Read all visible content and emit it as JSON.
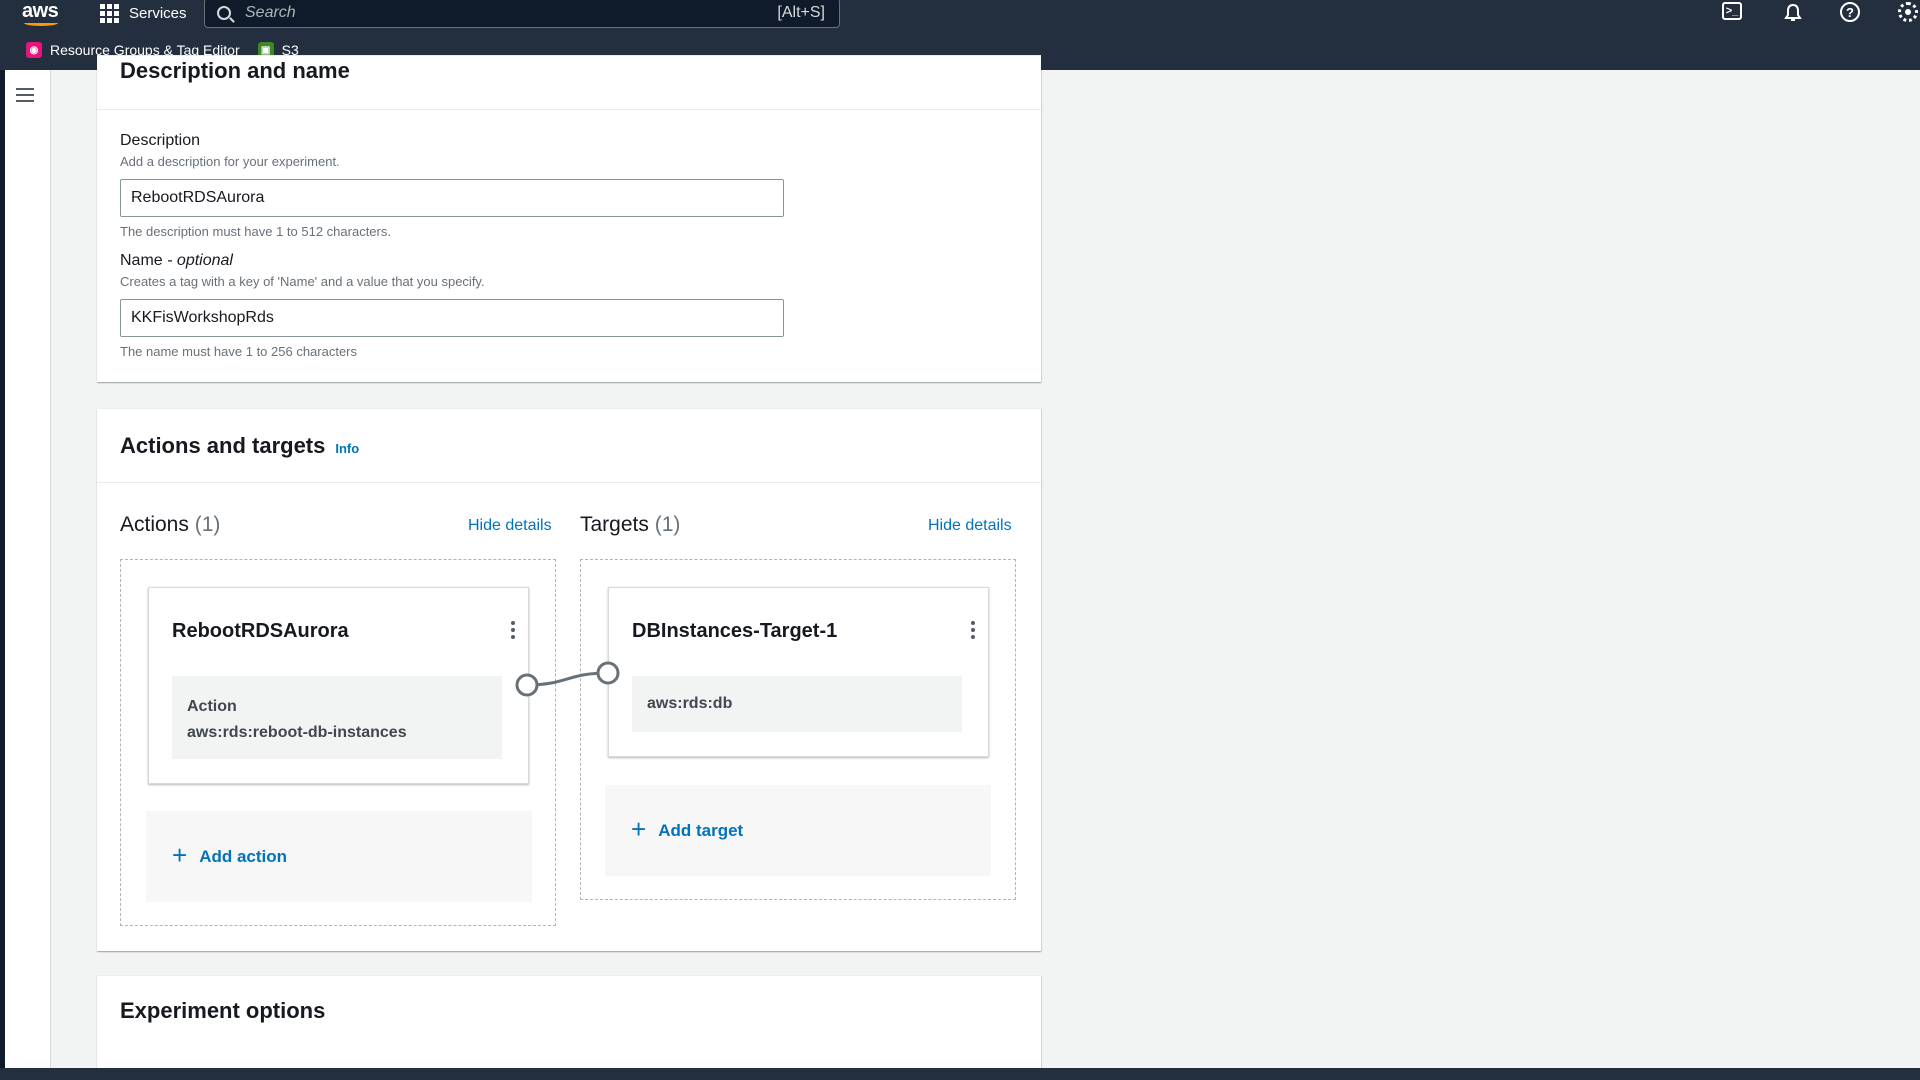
{
  "topnav": {
    "logo": "aws",
    "services_label": "Services",
    "search_placeholder": "Search",
    "search_shortcut": "[Alt+S]"
  },
  "favorites": [
    {
      "label": "Resource Groups & Tag Editor"
    },
    {
      "label": "S3"
    }
  ],
  "description_section": {
    "title": "Description and name",
    "description": {
      "label": "Description",
      "hint": "Add a description for your experiment.",
      "value": "RebootRDSAurora",
      "constraint": "The description must have 1 to 512 characters."
    },
    "name": {
      "label": "Name",
      "label_suffix": "- optional",
      "hint": "Creates a tag with a key of 'Name' and a value that you specify.",
      "value": "KKFisWorkshopRds",
      "constraint": "The name must have 1 to 256 characters"
    }
  },
  "actions_targets": {
    "title": "Actions and targets",
    "info": "Info",
    "actions": {
      "title": "Actions",
      "count": "(1)",
      "hide_details": "Hide details",
      "item": {
        "name": "RebootRDSAurora",
        "body_label": "Action",
        "body_value": "aws:rds:reboot-db-instances"
      },
      "add_label": "Add action"
    },
    "targets": {
      "title": "Targets",
      "count": "(1)",
      "hide_details": "Hide details",
      "item": {
        "name": "DBInstances-Target-1",
        "body_value": "aws:rds:db"
      },
      "add_label": "Add target"
    }
  },
  "experiment_options": {
    "title": "Experiment options"
  },
  "colors": {
    "nav_bg": "#232f3e",
    "link": "#0073bb",
    "accent": "#ff9900"
  }
}
